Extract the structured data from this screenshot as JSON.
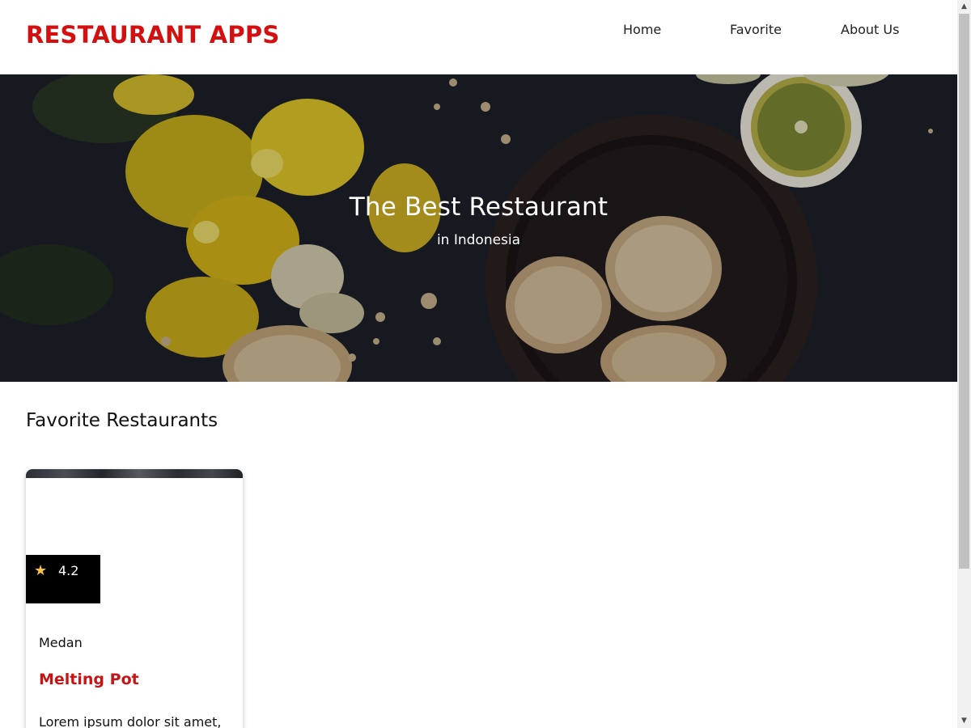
{
  "header": {
    "brand": "RESTAURANT APPS",
    "nav": [
      {
        "label": "Home"
      },
      {
        "label": "Favorite"
      },
      {
        "label": "About Us"
      }
    ]
  },
  "hero": {
    "title": "The Best Restaurant",
    "subtitle": "in Indonesia"
  },
  "main": {
    "section_title": "Favorite Restaurants",
    "restaurants": [
      {
        "rating": "4.2",
        "city": "Medan",
        "name": "Melting Pot",
        "description": "Lorem ipsum dolor sit amet,"
      }
    ]
  },
  "colors": {
    "brand": "#d30f0f",
    "restaurant_name": "#c81414",
    "rating_badge": "#000000",
    "star": "#f6c343"
  },
  "icons": {
    "rating": "star-icon",
    "scroll_up": "arrow-up-icon",
    "scroll_down": "arrow-down-icon"
  }
}
